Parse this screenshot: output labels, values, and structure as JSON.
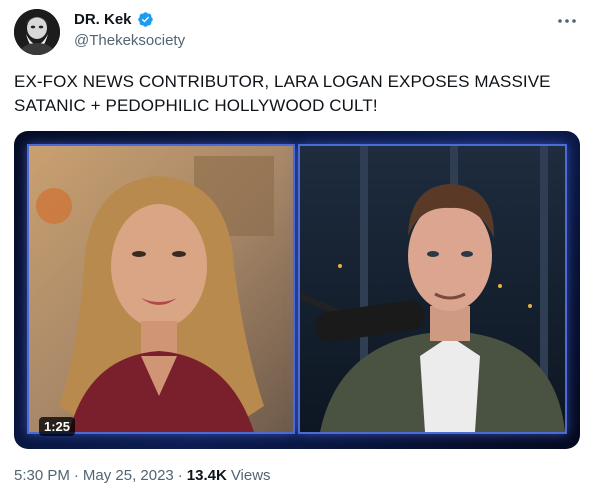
{
  "author": {
    "name": "DR. Kek",
    "handle": "@Thekeksociety",
    "verified": true
  },
  "tweet": {
    "text_line1": "EX-FOX NEWS CONTRIBUTOR, LARA LOGAN EXPOSES MASSIVE",
    "text_line2": "SATANIC + PEDOPHILIC HOLLYWOOD CULT!"
  },
  "video": {
    "duration": "1:25"
  },
  "meta": {
    "time": "5:30 PM",
    "separator": "·",
    "date": "May 25, 2023",
    "views_count": "13.4K",
    "views_label": "Views"
  },
  "colors": {
    "verified_badge": "#1d9bf0",
    "secondary_text": "#536471",
    "frame_glow": "#4a6bd8"
  }
}
